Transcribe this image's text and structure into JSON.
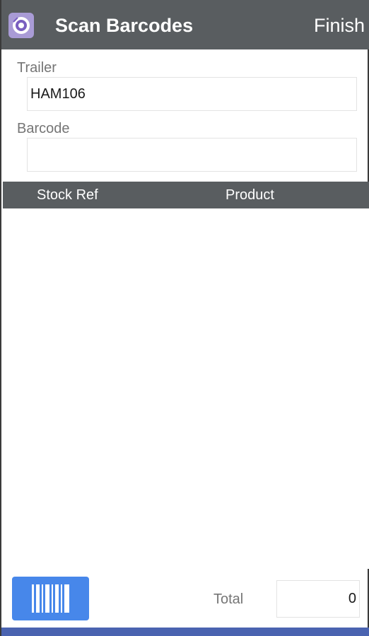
{
  "header": {
    "title": "Scan Barcodes",
    "finish_label": "Finish"
  },
  "form": {
    "trailer_label": "Trailer",
    "trailer_value": "HAM106",
    "barcode_label": "Barcode",
    "barcode_value": ""
  },
  "table": {
    "columns": [
      "Stock Ref",
      "Product"
    ]
  },
  "footer": {
    "total_label": "Total",
    "total_value": "0"
  },
  "colors": {
    "header_bg": "#595d60",
    "accent": "#4787ea",
    "bottom_strip": "#4a63b0"
  },
  "icons": {
    "logo": "app-logo-icon",
    "scan": "barcode-icon"
  }
}
